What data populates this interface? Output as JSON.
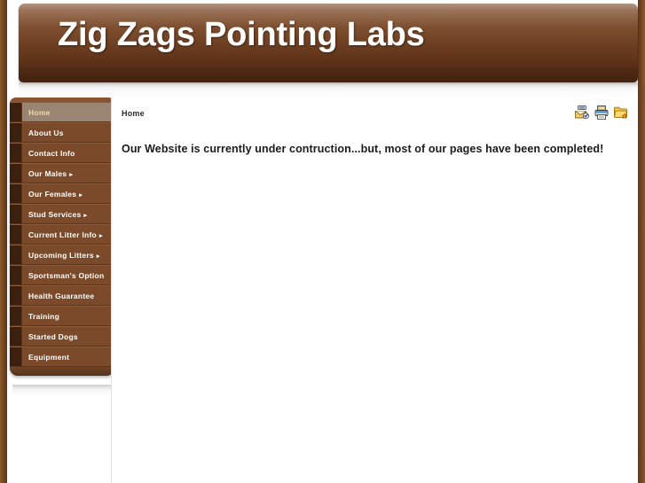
{
  "site": {
    "title": "Zig Zags Pointing Labs",
    "accent_color": "#7b4a2a",
    "header_gradient_top": "#b09585",
    "header_gradient_bottom": "#43230f",
    "active_item_bg": "#9a8472",
    "active_item_text": "#e9daa9"
  },
  "sidebar": {
    "items": [
      {
        "label": "Home",
        "has_submenu": false,
        "active": true
      },
      {
        "label": "About Us",
        "has_submenu": false,
        "active": false
      },
      {
        "label": "Contact Info",
        "has_submenu": false,
        "active": false
      },
      {
        "label": "Our Males",
        "has_submenu": true,
        "active": false
      },
      {
        "label": "Our Females",
        "has_submenu": true,
        "active": false
      },
      {
        "label": "Stud Services",
        "has_submenu": true,
        "active": false
      },
      {
        "label": "Current Litter Info",
        "has_submenu": true,
        "active": false
      },
      {
        "label": "Upcoming Litters",
        "has_submenu": true,
        "active": false
      },
      {
        "label": "Sportsman's Option",
        "has_submenu": false,
        "active": false
      },
      {
        "label": "Health Guarantee",
        "has_submenu": false,
        "active": false
      },
      {
        "label": "Training",
        "has_submenu": false,
        "active": false
      },
      {
        "label": "Started Dogs",
        "has_submenu": false,
        "active": false
      },
      {
        "label": "Equipment",
        "has_submenu": false,
        "active": false
      }
    ],
    "submenu_arrow": "▸"
  },
  "content": {
    "breadcrumb": "Home",
    "body_text": "Our Website is currently under contruction...but, most of our pages have been completed!"
  },
  "toolbar": {
    "icons": [
      {
        "name": "email-page-icon",
        "title": "Email this page"
      },
      {
        "name": "print-page-icon",
        "title": "Print this page"
      },
      {
        "name": "bookmark-page-icon",
        "title": "Add to favorites"
      }
    ]
  }
}
